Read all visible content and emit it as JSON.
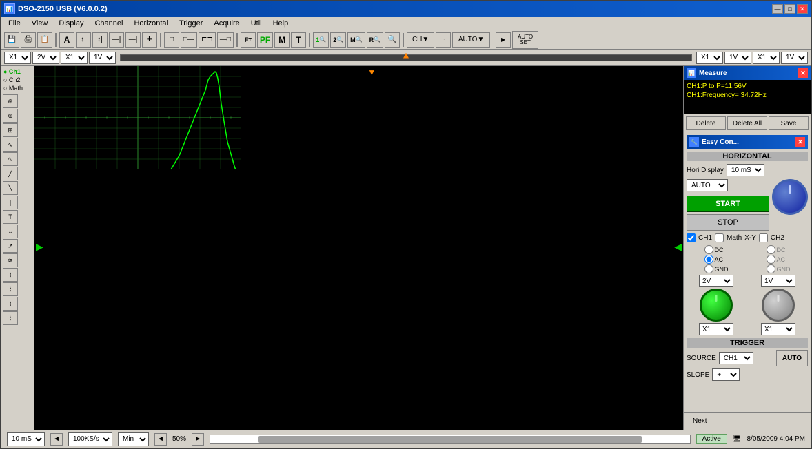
{
  "window": {
    "title": "DSO-2150 USB (V6.0.0.2)",
    "measure_panel_title": "Measure",
    "easy_con_title": "Easy Con..."
  },
  "menu": {
    "items": [
      "File",
      "View",
      "Display",
      "Channel",
      "Horizontal",
      "Trigger",
      "Acquire",
      "Util",
      "Help"
    ]
  },
  "toolbar": {
    "buttons": [
      "💾",
      "🖨",
      "📋",
      "A",
      "↕",
      "↕",
      "↕",
      "↕",
      "✚",
      "—",
      "□",
      "□",
      "□",
      "□"
    ],
    "ch_btn": "CH▼",
    "auto_btn": "AUTO▼",
    "autoset_label": "AUTO\nSET",
    "pf_label": "PF",
    "m_label": "M",
    "t_label": "T"
  },
  "channel_row": {
    "ch1_x": "X1",
    "ch1_v": "2V",
    "ch1_x2": "X1",
    "ch1_v2": "1V",
    "ch2_x": "X1",
    "ch2_v": "1V",
    "ch2_x2": "X1",
    "ch2_v2": "1V",
    "trigger_position": "50%"
  },
  "measure": {
    "title": "Measure",
    "ch1_p2p": "CH1:P to P=11.56V",
    "ch1_freq": "CH1:Frequency= 34.72Hz",
    "delete_btn": "Delete",
    "delete_all_btn": "Delete All",
    "save_btn": "Save"
  },
  "easy_con": {
    "title": "Easy Con...",
    "horizontal_title": "HORIZONTAL",
    "hori_display_label": "Hori Display",
    "hori_display_value": "10 mS",
    "auto_label": "AUTO",
    "start_btn": "START",
    "stop_btn": "STOP",
    "ch1_label": "CH1",
    "math_label": "Math",
    "xy_label": "X-Y",
    "ch2_label": "CH2",
    "dc_label": "DC",
    "ac_label": "AC",
    "gnd_label": "GND",
    "ch1_vol": "2V",
    "ch2_vol": "1V",
    "ch1_x": "X1",
    "ch2_x": "X1",
    "trigger_title": "TRIGGER",
    "source_label": "SOURCE",
    "ch1_source": "CH1▼",
    "slope_label": "SLOPE",
    "slope_value": "+",
    "auto_trigger_btn": "AUTO"
  },
  "status_bar": {
    "time_div": "10 mS",
    "sample_rate": "100KS/s",
    "min_label": "Min",
    "position_pct": "50%",
    "active_label": "Active",
    "datetime": "8/05/2009  4:04 PM"
  },
  "left_sidebar": {
    "ch1_radio": "● Ch1",
    "ch2_radio": "○ Ch2",
    "math_radio": "○ Math",
    "icons": [
      "⊕",
      "⊕",
      "⊕",
      "∿",
      "∿",
      "⌇",
      "⌇",
      "⌇",
      "⌇",
      "⌇",
      "⌇",
      "⌇",
      "∿",
      "⌇",
      "⌇",
      "⌇",
      "⌇"
    ]
  }
}
